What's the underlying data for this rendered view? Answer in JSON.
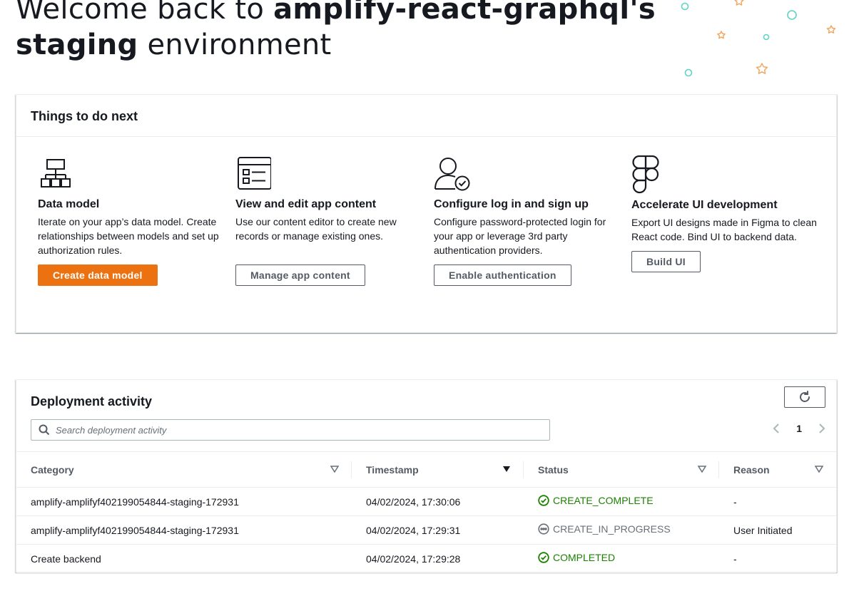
{
  "hero": {
    "prefix": "Welcome back to ",
    "app_name": "amplify-react-graphql's",
    "env_name": "staging",
    "suffix": " environment"
  },
  "todo": {
    "title": "Things to do next",
    "cards": [
      {
        "icon": "data-model-icon",
        "title": "Data model",
        "description": "Iterate on your app’s data model. Create relationships between models and set up authorization rules.",
        "button": "Create data model"
      },
      {
        "icon": "app-content-icon",
        "title": "View and edit app content",
        "description": "Use our content editor to create new records or manage existing ones.",
        "button": "Manage app content"
      },
      {
        "icon": "user-auth-icon",
        "title": "Configure log in and sign up",
        "description": "Configure password-protected login for your app or leverage 3rd party authentication providers.",
        "button": "Enable authentication"
      },
      {
        "icon": "figma-icon",
        "title": "Accelerate UI development",
        "description": "Export UI designs made in Figma to clean React code. Bind UI to backend data.",
        "button": "Build UI"
      }
    ]
  },
  "deployment": {
    "title": "Deployment activity",
    "search_placeholder": "Search deployment activity",
    "page": "1",
    "columns": [
      "Category",
      "Timestamp",
      "Status",
      "Reason"
    ],
    "rows": [
      {
        "category": "amplify-amplifyf402199054844-staging-172931",
        "timestamp": "04/02/2024, 17:30:06",
        "status": "CREATE_COMPLETE",
        "status_kind": "success",
        "reason": "-"
      },
      {
        "category": "amplify-amplifyf402199054844-staging-172931",
        "timestamp": "04/02/2024, 17:29:31",
        "status": "CREATE_IN_PROGRESS",
        "status_kind": "in-progress",
        "reason": "User Initiated"
      },
      {
        "category": "Create backend",
        "timestamp": "04/02/2024, 17:29:28",
        "status": "COMPLETED",
        "status_kind": "success",
        "reason": "-"
      }
    ]
  },
  "colors": {
    "primary_button": "#ec7211",
    "success": "#1d8102",
    "in_progress": "#687078",
    "confetti_circle": "#5fd4c4",
    "confetti_star": "#f2a45c"
  }
}
